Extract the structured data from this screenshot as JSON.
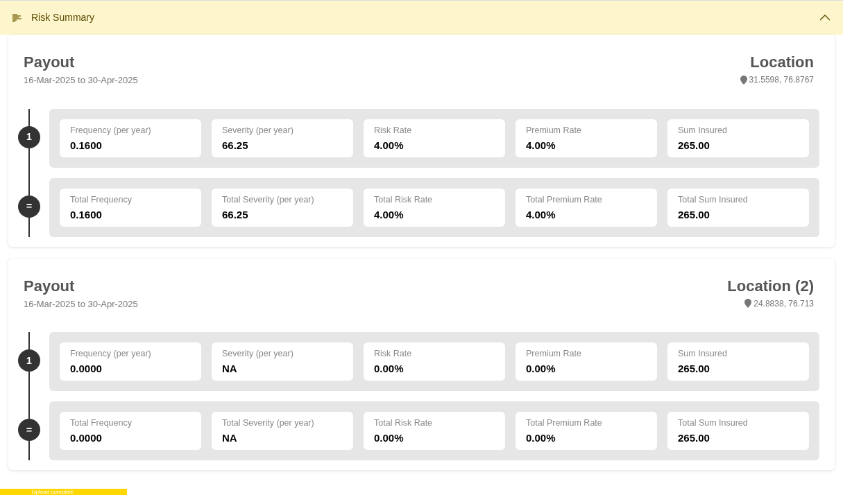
{
  "panel": {
    "title": "Risk Summary",
    "expanded": true
  },
  "sections": [
    {
      "title": "Payout",
      "dates": "16-Mar-2025 to 30-Apr-2025",
      "location_title": "Location",
      "coords": "31.5598, 76.8767",
      "rows": [
        {
          "marker": "1",
          "metrics": [
            {
              "label": "Frequency (per year)",
              "value": "0.1600"
            },
            {
              "label": "Severity (per year)",
              "value": "66.25"
            },
            {
              "label": "Risk Rate",
              "value": "4.00%"
            },
            {
              "label": "Premium Rate",
              "value": "4.00%"
            },
            {
              "label": "Sum Insured",
              "value": "265.00"
            }
          ]
        },
        {
          "marker": "=",
          "metrics": [
            {
              "label": "Total Frequency",
              "value": "0.1600"
            },
            {
              "label": "Total Severity (per year)",
              "value": "66.25"
            },
            {
              "label": "Total Risk Rate",
              "value": "4.00%"
            },
            {
              "label": "Total Premium Rate",
              "value": "4.00%"
            },
            {
              "label": "Total Sum Insured",
              "value": "265.00"
            }
          ]
        }
      ]
    },
    {
      "title": "Payout",
      "dates": "16-Mar-2025 to 30-Apr-2025",
      "location_title": "Location (2)",
      "coords": "24.8838, 76.713",
      "rows": [
        {
          "marker": "1",
          "metrics": [
            {
              "label": "Frequency (per year)",
              "value": "0.0000"
            },
            {
              "label": "Severity (per year)",
              "value": "NA"
            },
            {
              "label": "Risk Rate",
              "value": "0.00%"
            },
            {
              "label": "Premium Rate",
              "value": "0.00%"
            },
            {
              "label": "Sum Insured",
              "value": "265.00"
            }
          ]
        },
        {
          "marker": "=",
          "metrics": [
            {
              "label": "Total Frequency",
              "value": "0.0000"
            },
            {
              "label": "Total Severity (per year)",
              "value": "NA"
            },
            {
              "label": "Total Risk Rate",
              "value": "0.00%"
            },
            {
              "label": "Total Premium Rate",
              "value": "0.00%"
            },
            {
              "label": "Total Sum Insured",
              "value": "265.00"
            }
          ]
        }
      ]
    }
  ],
  "toast": "Upload complete"
}
